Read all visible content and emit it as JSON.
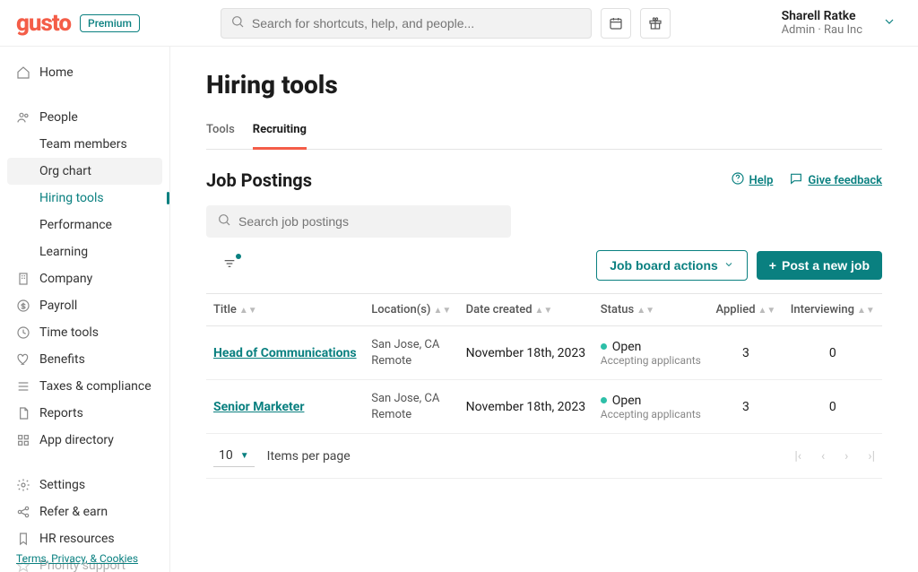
{
  "header": {
    "logo": "gusto",
    "badge": "Premium",
    "search_placeholder": "Search for shortcuts, help, and people...",
    "user_name": "Sharell Ratke",
    "user_role": "Admin",
    "user_separator": " · ",
    "user_company": "Rau Inc"
  },
  "sidebar": {
    "home": "Home",
    "people": "People",
    "people_children": {
      "team_members": "Team members",
      "org_chart": "Org chart",
      "hiring_tools": "Hiring tools",
      "performance": "Performance",
      "learning": "Learning"
    },
    "company": "Company",
    "payroll": "Payroll",
    "time_tools": "Time tools",
    "benefits": "Benefits",
    "taxes": "Taxes & compliance",
    "reports": "Reports",
    "app_directory": "App directory",
    "settings": "Settings",
    "refer": "Refer & earn",
    "hr": "HR resources",
    "priority": "Priority support",
    "footer": "Terms, Privacy, & Cookies"
  },
  "page": {
    "title": "Hiring tools",
    "tabs": {
      "tools": "Tools",
      "recruiting": "Recruiting"
    },
    "section_title": "Job Postings",
    "help": "Help",
    "feedback": "Give feedback",
    "table_search_placeholder": "Search job postings",
    "job_board_btn": "Job board actions",
    "post_btn": "Post a new job"
  },
  "table": {
    "columns": {
      "title": "Title",
      "locations": "Location(s)",
      "date": "Date created",
      "status": "Status",
      "applied": "Applied",
      "interviewing": "Interviewing"
    },
    "rows": [
      {
        "title": "Head of Communications",
        "loc1": "San Jose, CA",
        "loc2": "Remote",
        "date": "November 18th, 2023",
        "status": "Open",
        "status_sub": "Accepting applicants",
        "applied": "3",
        "interviewing": "0"
      },
      {
        "title": "Senior Marketer",
        "loc1": "San Jose, CA",
        "loc2": "Remote",
        "date": "November 18th, 2023",
        "status": "Open",
        "status_sub": "Accepting applicants",
        "applied": "3",
        "interviewing": "0"
      }
    ],
    "page_size": "10",
    "ipp_label": "Items per page"
  }
}
